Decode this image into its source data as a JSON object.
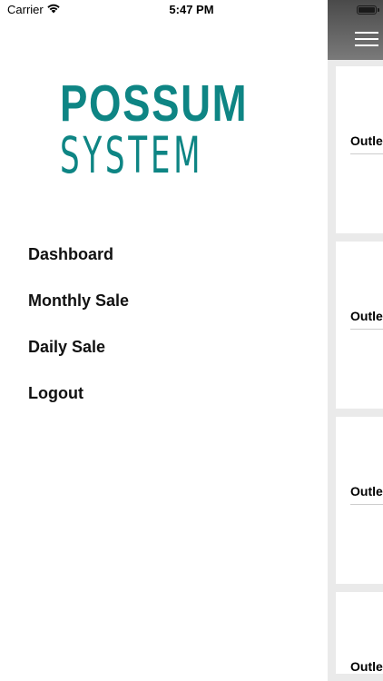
{
  "status_bar": {
    "carrier": "Carrier",
    "time": "5:47 PM",
    "icons": [
      "wifi-icon",
      "battery-icon"
    ]
  },
  "drawer": {
    "logo": {
      "line1": "POSSUM",
      "line2": "SYSTEM",
      "color": "#0e8584"
    },
    "menu": [
      {
        "label": "Dashboard"
      },
      {
        "label": "Monthly Sale"
      },
      {
        "label": "Daily Sale"
      },
      {
        "label": "Logout"
      }
    ]
  },
  "main": {
    "header_icon": "hamburger-menu-icon",
    "cards": [
      {
        "label": "Outle"
      },
      {
        "label": "Outle"
      },
      {
        "label": "Outle"
      },
      {
        "label": "Outle"
      }
    ]
  }
}
